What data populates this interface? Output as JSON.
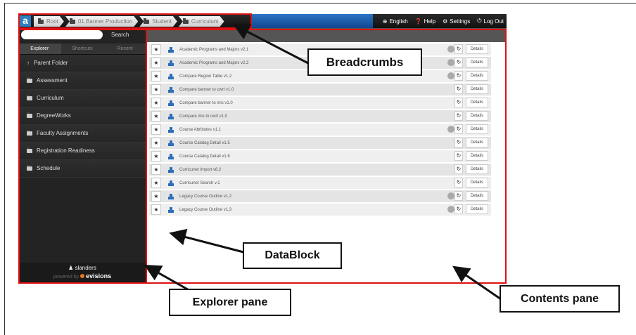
{
  "app": {
    "logo": "a",
    "breadcrumbs": [
      "Root",
      "01.Banner Production",
      "Student",
      "Curriculum"
    ],
    "topnav": [
      {
        "label": "English",
        "icon": "globe-icon"
      },
      {
        "label": "Help",
        "icon": "help-icon"
      },
      {
        "label": "Settings",
        "icon": "gear-icon"
      },
      {
        "label": "Log Out",
        "icon": "power-icon"
      }
    ]
  },
  "explorer": {
    "search_button": "Search",
    "tabs": [
      "Explorer",
      "Shortcuts",
      "Recent"
    ],
    "items": [
      "Parent Folder",
      "Assessment",
      "Curriculum",
      "DegreeWorks",
      "Faculty Assignments",
      "Registration Readiness",
      "Schedule"
    ],
    "user": "slanders",
    "powered_by": "powered by",
    "brand": "evisions"
  },
  "content": {
    "rows": [
      {
        "name": "Academic Programs and Majors v2.1",
        "info": true,
        "details": "Details"
      },
      {
        "name": "Academic Programs and Majors v2.2",
        "info": true,
        "details": "Details"
      },
      {
        "name": "Compare Region Table v1.2",
        "info": true,
        "details": "Details"
      },
      {
        "name": "Compare banner to cwrt v1.0",
        "info": false,
        "details": "Details"
      },
      {
        "name": "Compare banner to mis v1.0",
        "info": false,
        "details": "Details"
      },
      {
        "name": "Compare mis to cwrt v1.0",
        "info": false,
        "details": "Details"
      },
      {
        "name": "Course Attributes v1.1",
        "info": true,
        "details": "Details"
      },
      {
        "name": "Course Catalog Detail v1.5",
        "info": false,
        "details": "Details"
      },
      {
        "name": "Course Catalog Detail v1.6",
        "info": false,
        "details": "Details"
      },
      {
        "name": "Curricunet Import v8.2",
        "info": false,
        "details": "Details"
      },
      {
        "name": "Curricunet Search v.1",
        "info": false,
        "details": "Details"
      },
      {
        "name": "Legacy Course Outline v1.2",
        "info": true,
        "details": "Details"
      },
      {
        "name": "Legacy Course Outline v1.3",
        "info": true,
        "details": "Details"
      }
    ]
  },
  "callouts": {
    "breadcrumbs": "Breadcrumbs",
    "datablock": "DataBlock",
    "explorer": "Explorer pane",
    "contents": "Contents pane"
  },
  "colors": {
    "annotation_red": "#e01010",
    "accent_blue": "#2c73c4"
  }
}
